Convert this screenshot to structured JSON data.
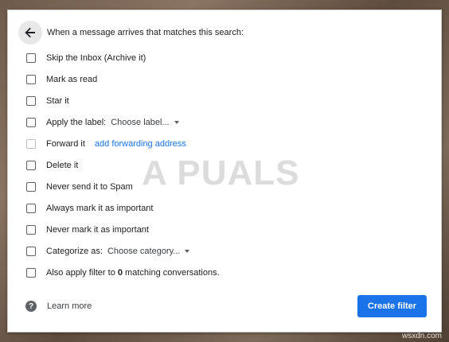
{
  "header": {
    "text": "When a message arrives that matches this search:"
  },
  "options": [
    {
      "label": "Skip the Inbox (Archive it)"
    },
    {
      "label": "Mark as read"
    },
    {
      "label": "Star it"
    },
    {
      "label": "Apply the label:",
      "dropdown": "Choose label..."
    },
    {
      "label": "Forward it",
      "link": "add forwarding address",
      "disabled": true
    },
    {
      "label": "Delete it"
    },
    {
      "label": "Never send it to Spam"
    },
    {
      "label": "Always mark it as important"
    },
    {
      "label": "Never mark it as important"
    },
    {
      "label": "Categorize as:",
      "dropdown": "Choose category..."
    },
    {
      "label_prefix": "Also apply filter to ",
      "count": "0",
      "label_suffix": " matching conversations."
    }
  ],
  "footer": {
    "help_glyph": "?",
    "learn_more": "Learn more",
    "create_button": "Create filter"
  },
  "watermark": "A  PUALS",
  "site_mark": "wsxdn.com",
  "colors": {
    "primary": "#1a73e8",
    "text": "#202124",
    "checkbox": "#5f6368"
  }
}
